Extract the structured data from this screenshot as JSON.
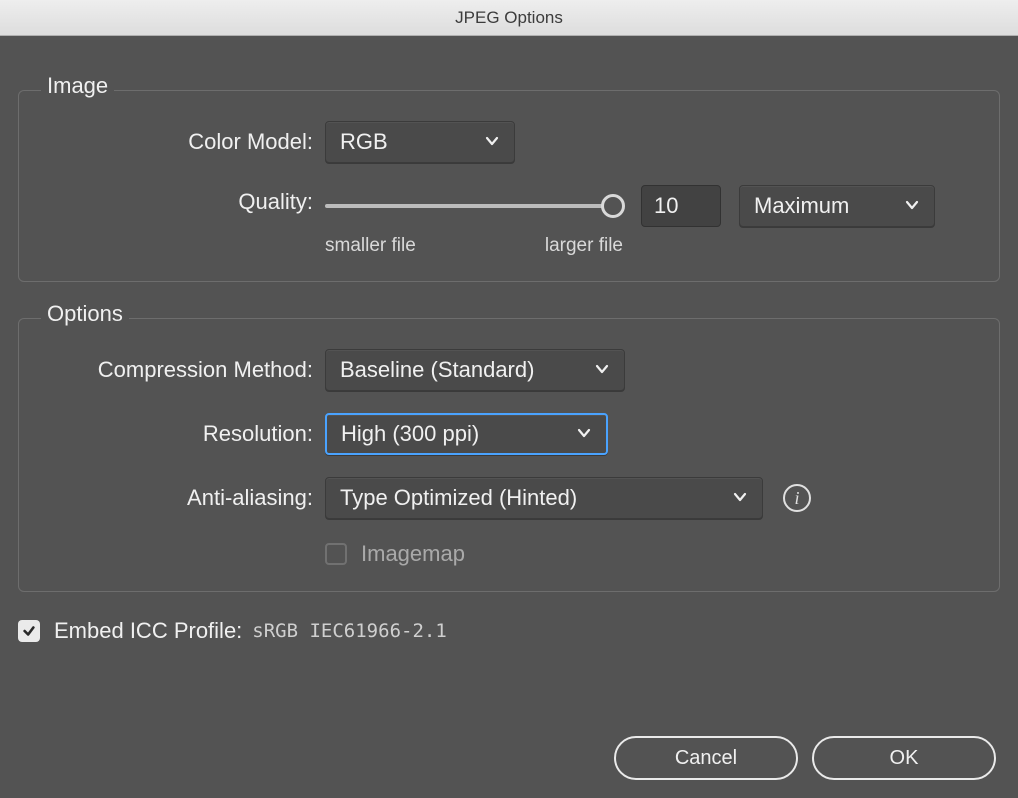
{
  "dialog": {
    "title": "JPEG Options"
  },
  "image": {
    "section_title": "Image",
    "color_model_label": "Color Model:",
    "color_model_value": "RGB",
    "quality_label": "Quality:",
    "slider_min_label": "smaller file",
    "slider_max_label": "larger file",
    "quality_value": "10",
    "quality_preset": "Maximum"
  },
  "options": {
    "section_title": "Options",
    "compression_label": "Compression Method:",
    "compression_value": "Baseline (Standard)",
    "resolution_label": "Resolution:",
    "resolution_value": "High (300 ppi)",
    "antialias_label": "Anti-aliasing:",
    "antialias_value": "Type Optimized (Hinted)",
    "imagemap_label": "Imagemap"
  },
  "embed": {
    "label": "Embed ICC Profile:",
    "profile_name": "sRGB IEC61966-2.1"
  },
  "footer": {
    "cancel": "Cancel",
    "ok": "OK"
  }
}
